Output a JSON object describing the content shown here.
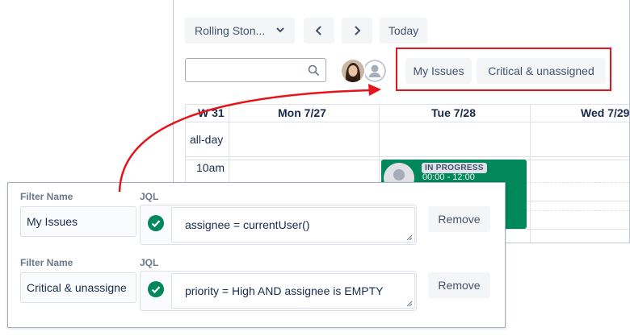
{
  "calendar": {
    "project_select": "Rolling Ston...",
    "today_label": "Today",
    "filter_buttons": [
      "My Issues",
      "Critical & unassigned"
    ],
    "week_label": "W 31",
    "days": [
      "Mon 7/27",
      "Tue 7/28",
      "Wed 7/29"
    ],
    "allday_label": "all-day",
    "time_label": "10am",
    "event": {
      "status": "IN PROGRESS",
      "time": "00:00 - 12:00",
      "color": "#00875a"
    }
  },
  "filters": {
    "name_label": "Filter Name",
    "jql_label": "JQL",
    "remove_label": "Remove",
    "rows": [
      {
        "name": "My Issues",
        "jql": "assignee = currentUser()"
      },
      {
        "name": "Critical & unassigne",
        "jql": "priority = High AND assignee is EMPTY"
      }
    ]
  },
  "colors": {
    "highlight": "#e5141b",
    "valid_check": "#00875a"
  }
}
